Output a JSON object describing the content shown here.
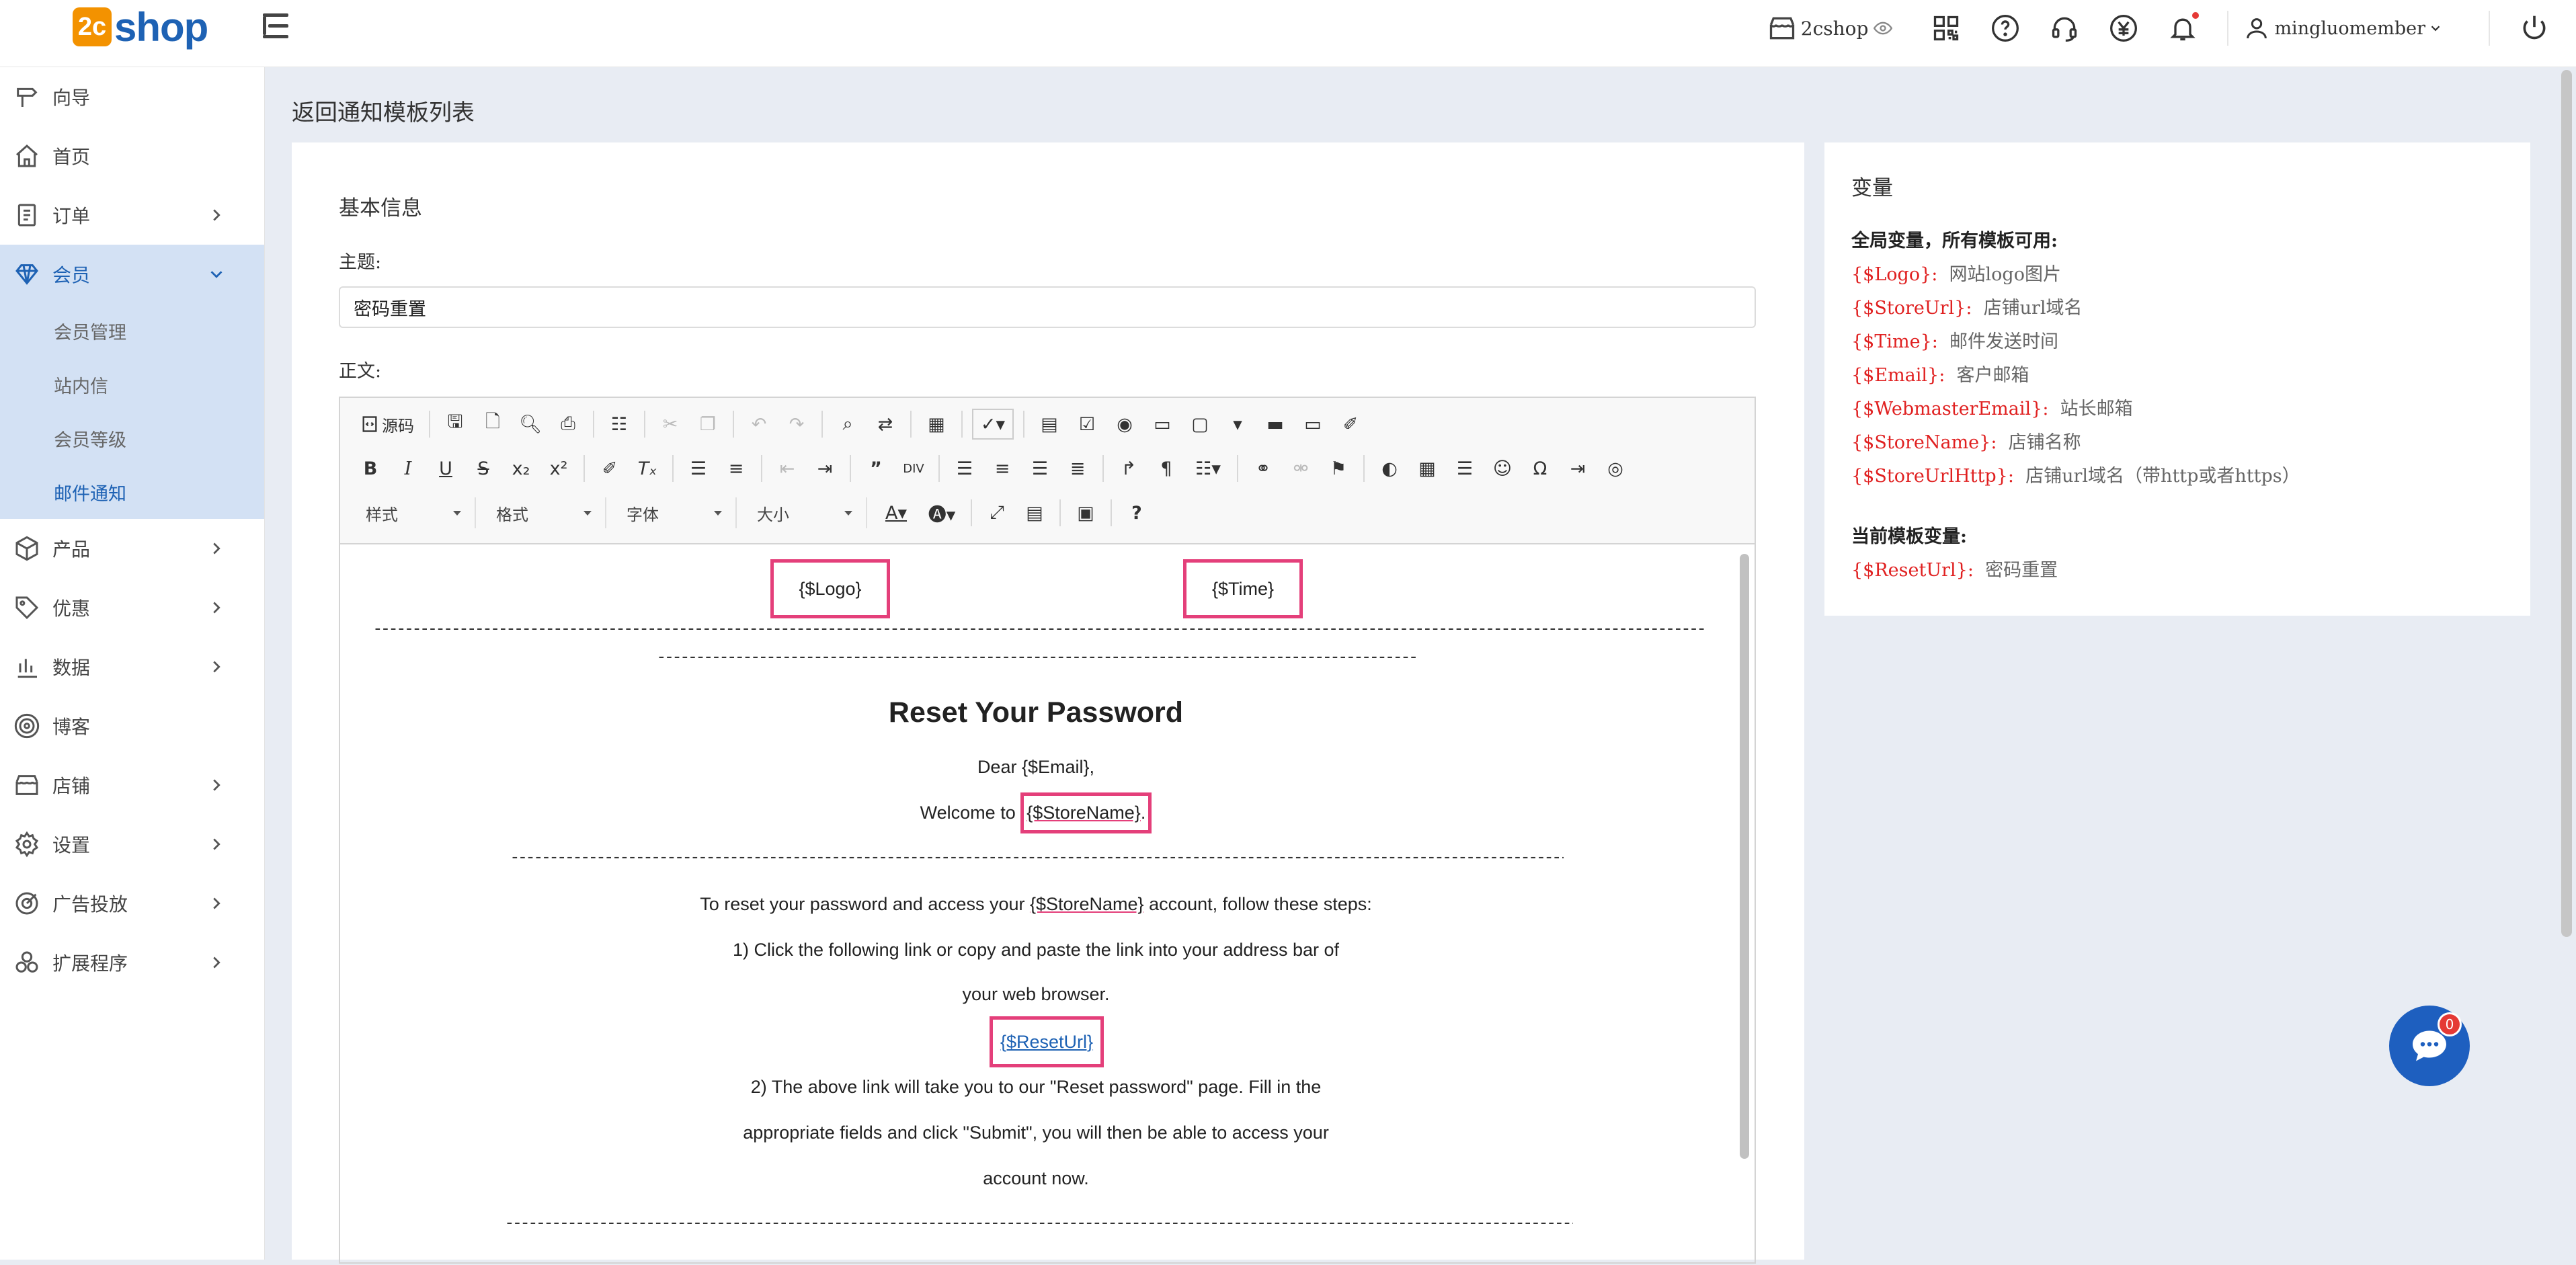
{
  "topbar": {
    "logo_badge": "2c",
    "logo_word": "shop",
    "shop_name": "2cshop",
    "username": "mingluomember"
  },
  "sidebar": {
    "items": [
      {
        "label": "向导",
        "icon": "signpost-icon",
        "chevron": false
      },
      {
        "label": "首页",
        "icon": "home-icon",
        "chevron": false
      },
      {
        "label": "订单",
        "icon": "order-icon",
        "chevron": true
      },
      {
        "label": "会员",
        "icon": "diamond-icon",
        "chevron": true,
        "active": true
      },
      {
        "label": "产品",
        "icon": "cube-icon",
        "chevron": true
      },
      {
        "label": "优惠",
        "icon": "tag-icon",
        "chevron": true
      },
      {
        "label": "数据",
        "icon": "chart-icon",
        "chevron": true
      },
      {
        "label": "博客",
        "icon": "target-icon",
        "chevron": false
      },
      {
        "label": "店铺",
        "icon": "store-icon",
        "chevron": true
      },
      {
        "label": "设置",
        "icon": "gear-icon",
        "chevron": true
      },
      {
        "label": "广告投放",
        "icon": "ad-icon",
        "chevron": true
      },
      {
        "label": "扩展程序",
        "icon": "extension-icon",
        "chevron": true
      }
    ],
    "sub_items": [
      "会员管理",
      "站内信",
      "会员等级",
      "邮件通知"
    ]
  },
  "page_title": "返回通知模板列表",
  "basic": {
    "title": "基本信息",
    "subject_label": "主题:",
    "subject_value": "密码重置",
    "body_label": "正文:"
  },
  "toolbar": {
    "source_label": "源码",
    "style_label": "样式",
    "format_label": "格式",
    "font_label": "字体",
    "size_label": "大小"
  },
  "email": {
    "logo_var": "{$Logo}",
    "time_var": "{$Time}",
    "heading": "Reset Your Password",
    "dear_prefix": "Dear ",
    "email_var": "{$Email}",
    "dear_suffix": ",",
    "welcome_prefix": "Welcome to ",
    "storename_var": "{$StoreName}",
    "welcome_suffix": ".",
    "reset_prefix": "To reset your password and access your ",
    "reset_suffix": " account, follow these steps:",
    "step1_a": "1)  Click the following link or copy and paste the link into your address bar of",
    "step1_b": "your web browser.",
    "reseturl_var": "{$ResetUrl}",
    "step2_a": "2)  The above link will take you to our \"Reset password\" page. Fill in the",
    "step2_b": "appropriate fields and click \"Submit\", you will then be able to access your",
    "step2_c": "account now."
  },
  "variables": {
    "title": "变量",
    "global_title": "全局变量，所有模板可用:",
    "global": [
      {
        "key": "{$Logo}:",
        "desc": "网站logo图片"
      },
      {
        "key": "{$StoreUrl}:",
        "desc": "店铺url域名"
      },
      {
        "key": "{$Time}:",
        "desc": "邮件发送时间"
      },
      {
        "key": "{$Email}:",
        "desc": "客户邮箱"
      },
      {
        "key": "{$WebmasterEmail}:",
        "desc": "站长邮箱"
      },
      {
        "key": "{$StoreName}:",
        "desc": "店铺名称"
      },
      {
        "key": "{$StoreUrlHttp}:",
        "desc": "店铺url域名（带http或者https）"
      }
    ],
    "current_title": "当前模板变量:",
    "current": [
      {
        "key": "{$ResetUrl}:",
        "desc": "密码重置"
      }
    ]
  },
  "chat": {
    "count": "0"
  },
  "colors": {
    "accent": "#1e62b4",
    "highlight": "#e43f7a",
    "variable": "#e02020"
  }
}
